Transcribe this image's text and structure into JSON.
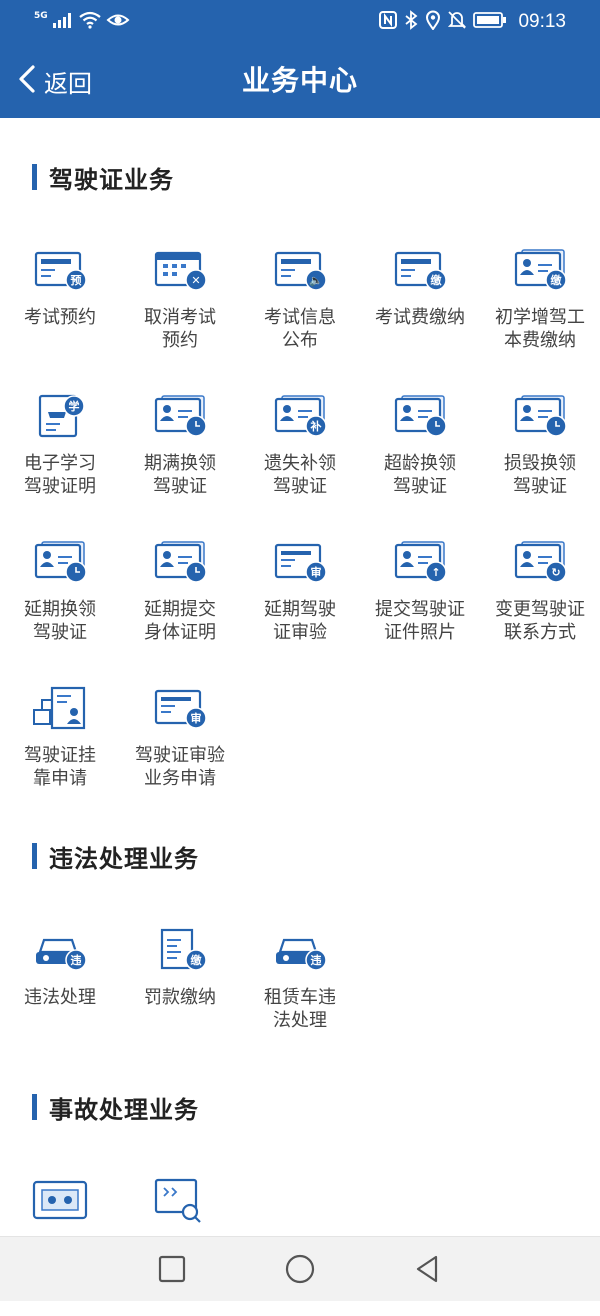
{
  "status_bar": {
    "network": "5G",
    "time": "09:13",
    "icons": [
      "signal-icon",
      "wifi-icon",
      "eye-icon",
      "nfc-icon",
      "bluetooth-icon",
      "location-icon",
      "mute-icon",
      "battery-icon"
    ]
  },
  "header": {
    "back_label": "返回",
    "title": "业务中心"
  },
  "colors": {
    "brand": "#2563ae",
    "accent": "#3a78c9"
  },
  "sections": [
    {
      "title": "驾驶证业务",
      "items": [
        {
          "label": "考试预约",
          "icon": "exam-booking-icon",
          "badge": "预"
        },
        {
          "label": "取消考试\n预约",
          "icon": "cancel-exam-icon",
          "badge": "✕"
        },
        {
          "label": "考试信息\n公布",
          "icon": "exam-info-icon",
          "badge": "🔈"
        },
        {
          "label": "考试费缴纳",
          "icon": "exam-fee-icon",
          "badge": "缴"
        },
        {
          "label": "初学增驾工\n本费缴纳",
          "icon": "cost-fee-icon",
          "badge": "缴"
        },
        {
          "label": "电子学习\n驾驶证明",
          "icon": "learner-permit-icon",
          "badge": "学"
        },
        {
          "label": "期满换领\n驾驶证",
          "icon": "expiry-renew-icon",
          "badge": ""
        },
        {
          "label": "遗失补领\n驾驶证",
          "icon": "lost-replace-icon",
          "badge": "补"
        },
        {
          "label": "超龄换领\n驾驶证",
          "icon": "overage-renew-icon",
          "badge": ""
        },
        {
          "label": "损毁换领\n驾驶证",
          "icon": "damaged-renew-icon",
          "badge": ""
        },
        {
          "label": "延期换领\n驾驶证",
          "icon": "delay-renew-icon",
          "badge": ""
        },
        {
          "label": "延期提交\n身体证明",
          "icon": "delay-health-icon",
          "badge": ""
        },
        {
          "label": "延期驾驶\n证审验",
          "icon": "delay-review-icon",
          "badge": "审"
        },
        {
          "label": "提交驾驶证\n证件照片",
          "icon": "submit-photo-icon",
          "badge": "↑"
        },
        {
          "label": "变更驾驶证\n联系方式",
          "icon": "change-contact-icon",
          "badge": "↻"
        },
        {
          "label": "驾驶证挂\n靠申请",
          "icon": "affiliation-icon",
          "badge": ""
        },
        {
          "label": "驾驶证审验\n业务申请",
          "icon": "review-apply-icon",
          "badge": "审"
        }
      ]
    },
    {
      "title": "违法处理业务",
      "items": [
        {
          "label": "违法处理",
          "icon": "violation-car-icon",
          "badge": "违"
        },
        {
          "label": "罚款缴纳",
          "icon": "fine-payment-icon",
          "badge": "缴"
        },
        {
          "label": "租赁车违\n法处理",
          "icon": "rental-violation-icon",
          "badge": "违"
        }
      ]
    },
    {
      "title": "事故处理业务",
      "items": [
        {
          "label": "",
          "icon": "accident-photo-icon",
          "badge": ""
        },
        {
          "label": "",
          "icon": "accident-search-icon",
          "badge": ""
        }
      ]
    }
  ],
  "bottom_nav": [
    "recent-apps-button",
    "home-button",
    "back-nav-button"
  ]
}
